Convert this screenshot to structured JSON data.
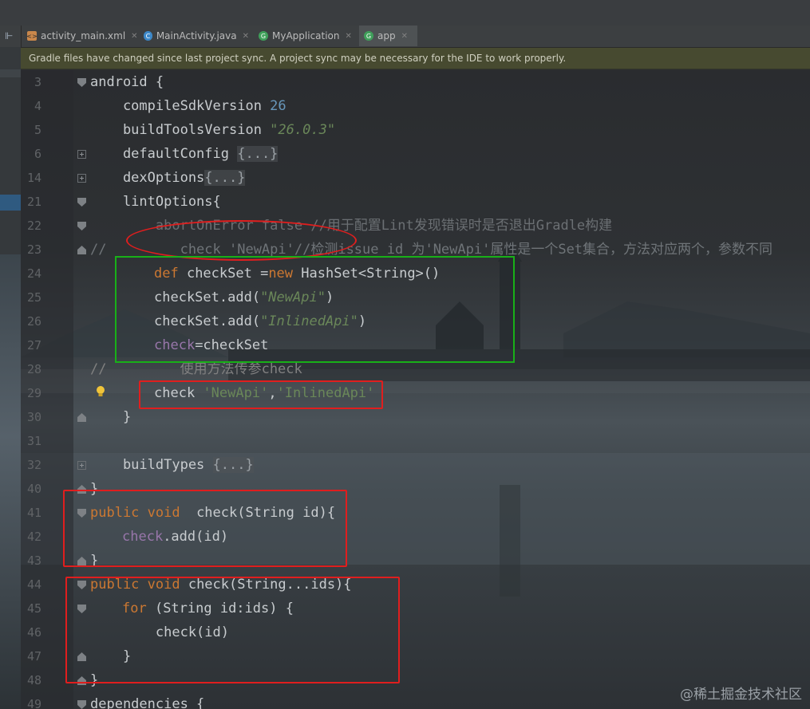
{
  "tabs": [
    {
      "label": "activity_main.xml",
      "icon": "xml-file-icon"
    },
    {
      "label": "MainActivity.java",
      "icon": "java-class-icon"
    },
    {
      "label": "MyApplication",
      "icon": "gradle-icon"
    },
    {
      "label": "app",
      "icon": "gradle-icon"
    }
  ],
  "notification": "Gradle files have changed since last project sync. A project sync may be necessary for the IDE to work properly.",
  "editor": {
    "line_numbers": [
      "3",
      "4",
      "5",
      "6",
      "14",
      "21",
      "22",
      "23",
      "24",
      "25",
      "26",
      "27",
      "28",
      "29",
      "30",
      "31",
      "32",
      "40",
      "41",
      "42",
      "43",
      "44",
      "45",
      "46",
      "47",
      "48",
      "49"
    ],
    "lines": {
      "l3": {
        "a": "android {"
      },
      "l4": {
        "a": "    compileSdkVersion ",
        "b": "26"
      },
      "l5": {
        "a": "    buildToolsVersion ",
        "b": "\"26.0.3\""
      },
      "l6": {
        "a": "    defaultConfig ",
        "b": "{...}"
      },
      "l14": {
        "a": "    dexOptions",
        "b": "{...}"
      },
      "l21": {
        "a": "    lintOptions{"
      },
      "l22": {
        "a": "        abortOnError false //用于配置Lint发现错误时是否退出Gradle构建"
      },
      "l23": {
        "a": "//         check 'NewApi'//检测issue id 为'NewApi'属性是一个Set集合，方法对应两个，参数不同"
      },
      "l24": {
        "a": "def",
        "b": " checkSet =",
        "c": "new",
        "d": " HashSet<String>()"
      },
      "l25": {
        "a": "checkSet.add(",
        "b": "\"NewApi\"",
        "c": ")"
      },
      "l26": {
        "a": "checkSet.add(",
        "b": "\"InlinedApi\"",
        "c": ")"
      },
      "l27": {
        "a": "check",
        "b": "=checkSet"
      },
      "l28": {
        "a": "//         使用方法传参check"
      },
      "l29": {
        "a": "check ",
        "b": "'NewApi'",
        "c": ",",
        "d": "'InlinedApi'"
      },
      "l30": {
        "a": "    }"
      },
      "l32": {
        "a": "    buildTypes ",
        "b": "{...}"
      },
      "l40": {
        "a": "}"
      },
      "l41": {
        "a": "public void",
        "b": "  check(String id){"
      },
      "l42": {
        "a": "check",
        "b": ".add(id)"
      },
      "l43": {
        "a": "}"
      },
      "l44": {
        "a": "public void",
        "b": " check(String...ids){"
      },
      "l45": {
        "a": "for",
        "b": " (String id:ids) {"
      },
      "l46": {
        "a": "        check(id)"
      },
      "l47": {
        "a": "    }"
      },
      "l48": {
        "a": "}"
      },
      "l49": {
        "a": "dependencies {"
      }
    }
  },
  "watermark": "@稀土掘金技术社区",
  "colors": {
    "keyword": "#cc7832",
    "string": "#6a8759",
    "number": "#6897bb",
    "comment": "#808080",
    "field": "#9876aa",
    "annotation_red": "#e01e1e",
    "annotation_green": "#18b018"
  }
}
